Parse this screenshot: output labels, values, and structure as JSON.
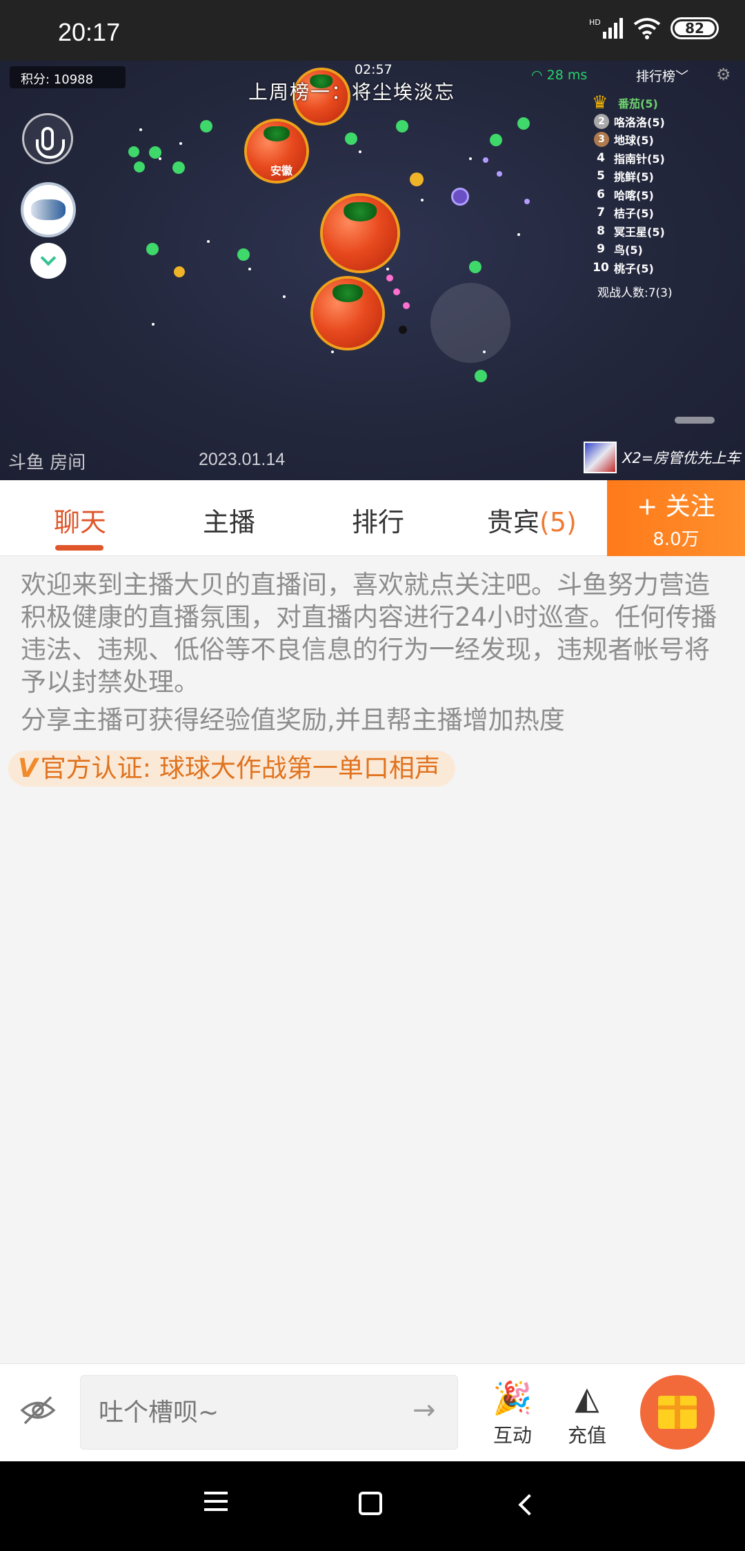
{
  "status_bar": {
    "time": "20:17",
    "network": "HD",
    "battery": "82"
  },
  "video": {
    "score": "积分: 10988",
    "timer": "02:57",
    "banner": "上周榜一：将尘埃淡忘",
    "ping": "28 ms",
    "rank_toggle": "排行榜﹀",
    "tomato_label": "安徽",
    "leaderboard": [
      {
        "rank": "",
        "name": "番茄(5)"
      },
      {
        "rank": "2",
        "name": "咯洛洛(5)"
      },
      {
        "rank": "3",
        "name": "地球(5)"
      },
      {
        "rank": "4",
        "name": "指南针(5)"
      },
      {
        "rank": "5",
        "name": "挑鲜(5)"
      },
      {
        "rank": "6",
        "name": "哈喀(5)"
      },
      {
        "rank": "7",
        "name": "桔子(5)"
      },
      {
        "rank": "8",
        "name": "冥王星(5)"
      },
      {
        "rank": "9",
        "name": "鸟(5)"
      },
      {
        "rank": "10",
        "name": "桃子(5)"
      }
    ],
    "spectators": "观战人数:7(3)",
    "watermark": "斗鱼 房间",
    "date": "2023.01.14",
    "promo": "X2=房管优先上车"
  },
  "tabs": {
    "chat": "聊天",
    "anchor": "主播",
    "ranking": "排行",
    "vip": "贵宾",
    "vip_count": "(5)",
    "follow_label": "+ 关注",
    "follow_count": "8.0万"
  },
  "chat": {
    "welcome": "欢迎来到主播大贝的直播间，喜欢就点关注吧。斗鱼努力营造积极健康的直播氛围，对直播内容进行24小时巡查。任何传播违法、违规、低俗等不良信息的行为一经发现，违规者帐号将予以封禁处理。",
    "share": "分享主播可获得经验值奖励,并且帮主播增加热度",
    "verified_mark": "V",
    "verified": "官方认证: 球球大作战第一单口相声"
  },
  "input_bar": {
    "placeholder": "吐个槽呗~",
    "interact": "互动",
    "recharge": "充值"
  },
  "colors": {
    "accent": "#e0562a",
    "follow": "#ff7a1a",
    "gift": "#f26a3a"
  }
}
